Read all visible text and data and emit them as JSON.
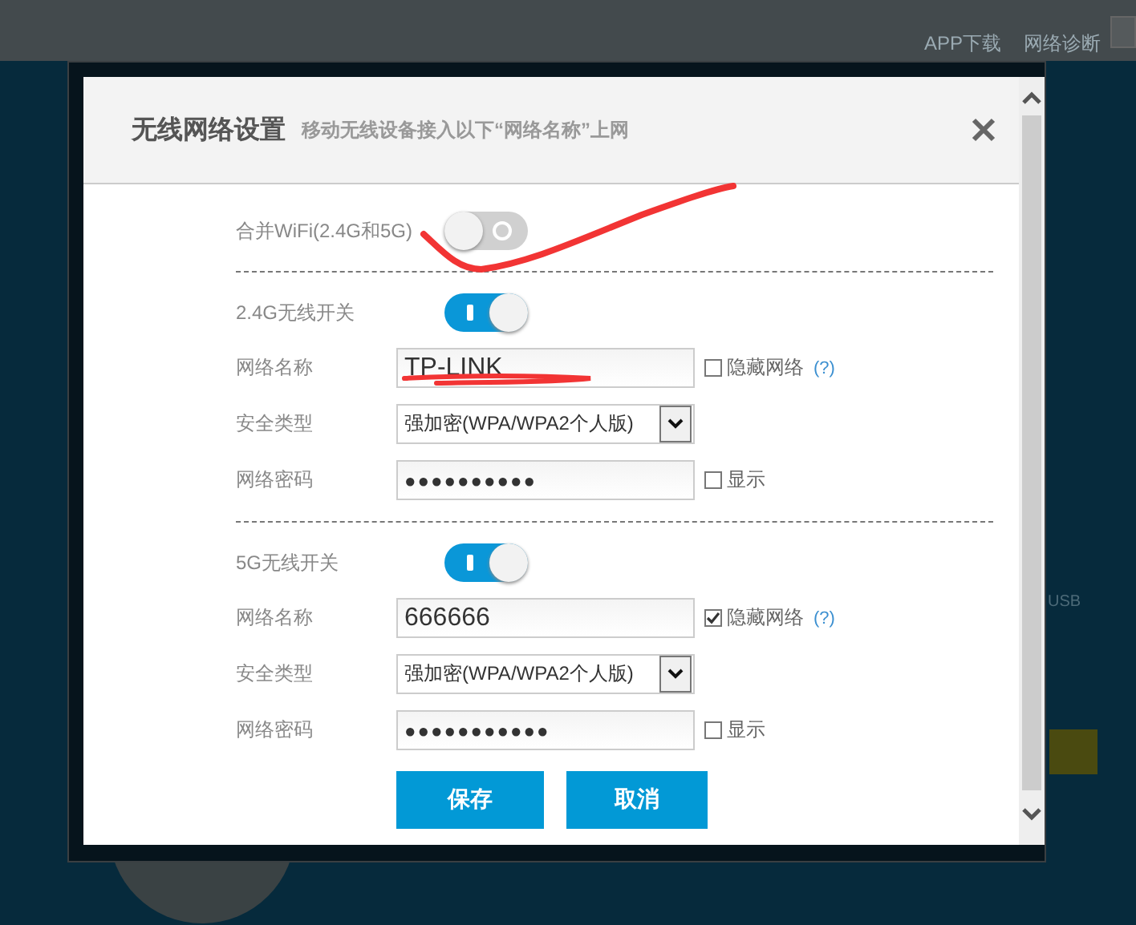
{
  "background": {
    "links": [
      "APP下载",
      "网络诊断"
    ],
    "usb_label": "USB"
  },
  "dialog": {
    "title": "无线网络设置",
    "subtitle": "移动无线设备接入以下“网络名称”上网"
  },
  "merge": {
    "label": "合并WiFi(2.4G和5G)",
    "on": false
  },
  "bands": [
    {
      "switch_label": "2.4G无线开关",
      "on": true,
      "name_label": "网络名称",
      "name_value": "TP-LINK",
      "hide_label": "隐藏网络",
      "hide_checked": false,
      "help": "(?)",
      "security_label": "安全类型",
      "security_value": "强加密(WPA/WPA2个人版)",
      "password_label": "网络密码",
      "password_value": "●●●●●●●●●●",
      "show_label": "显示",
      "show_checked": false
    },
    {
      "switch_label": "5G无线开关",
      "on": true,
      "name_label": "网络名称",
      "name_value": "666666",
      "hide_label": "隐藏网络",
      "hide_checked": true,
      "help": "(?)",
      "security_label": "安全类型",
      "security_value": "强加密(WPA/WPA2个人版)",
      "password_label": "网络密码",
      "password_value": "●●●●●●●●●●●",
      "show_label": "显示",
      "show_checked": false
    }
  ],
  "buttons": [
    "保存",
    "取消"
  ],
  "annotations": [
    {
      "kind": "curve"
    },
    {
      "kind": "scribble"
    }
  ]
}
